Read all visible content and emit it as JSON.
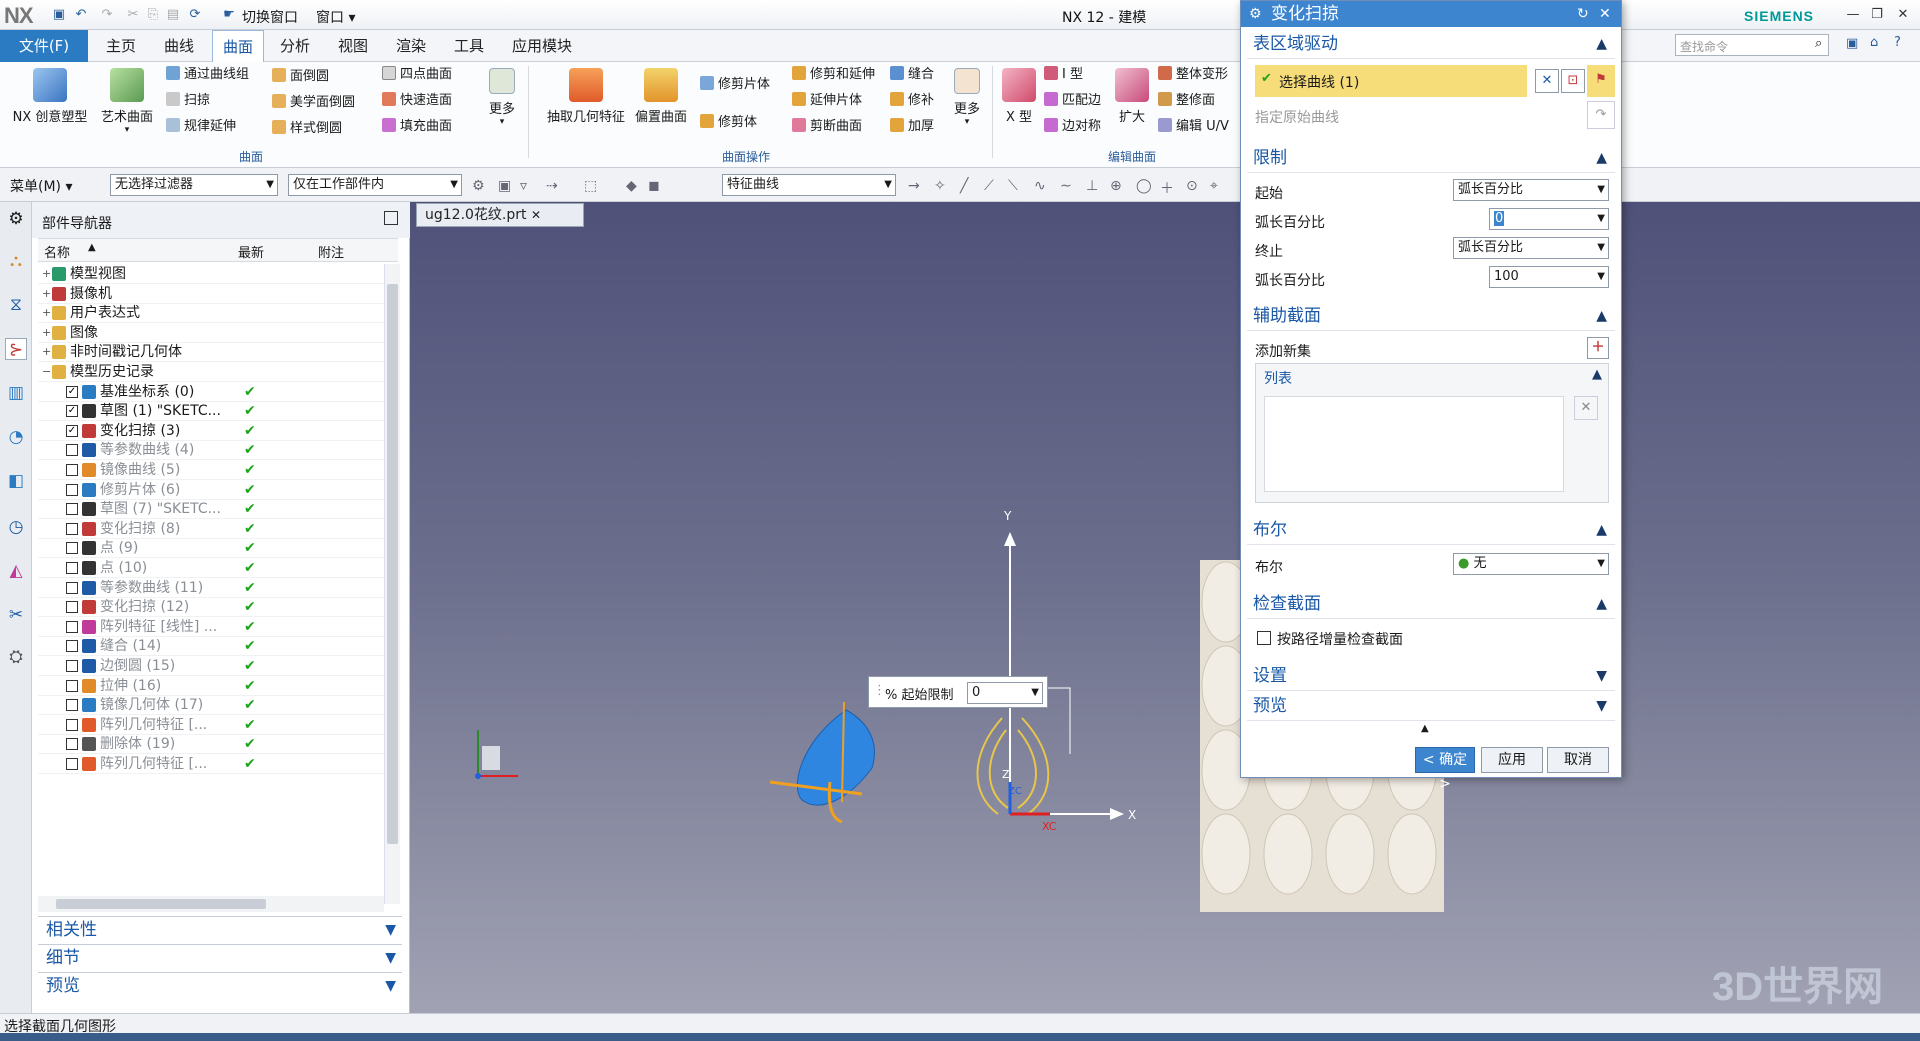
{
  "titlebar": {
    "logo": "NX",
    "switch_window": "切换窗口",
    "window": "窗口",
    "app_title": "NX 12 - 建模",
    "brand": "SIEMENS"
  },
  "menu": {
    "file": "文件(F)",
    "tabs": [
      "主页",
      "曲线",
      "曲面",
      "分析",
      "视图",
      "渲染",
      "工具",
      "应用模块"
    ],
    "search_placeholder": "查找命令"
  },
  "ribbon": {
    "big": [
      "NX 创意塑型",
      "艺术曲面",
      "抽取几何特征",
      "偏置曲面",
      "X 型",
      "扩大",
      "更多",
      "更多"
    ],
    "small": [
      "通过曲线组",
      "扫掠",
      "规律延伸",
      "面倒圆",
      "美学面倒圆",
      "样式倒圆",
      "四点曲面",
      "快速造面",
      "填充曲面",
      "修剪片体",
      "修剪体",
      "修剪和延伸",
      "延伸片体",
      "剪断曲面",
      "缝合",
      "修补",
      "加厚",
      "I 型",
      "匹配边",
      "边对称",
      "整体变形",
      "整修面",
      "编辑 U/V"
    ],
    "groups": [
      "曲面",
      "曲面操作",
      "编辑曲面"
    ]
  },
  "selbar": {
    "menu": "菜单(M)",
    "filter": "无选择过滤器",
    "scope": "仅在工作部件内",
    "curve_rule": "特征曲线"
  },
  "navigator": {
    "title": "部件导航器",
    "columns": [
      "名称",
      "最新",
      "附注"
    ],
    "rows": [
      {
        "label": "模型视图",
        "gray": false,
        "ok": false
      },
      {
        "label": "摄像机",
        "gray": false,
        "ok": false
      },
      {
        "label": "用户表达式",
        "gray": false,
        "ok": false
      },
      {
        "label": "图像",
        "gray": false,
        "ok": false
      },
      {
        "label": "非时间戳记几何体",
        "gray": false,
        "ok": false
      },
      {
        "label": "模型历史记录",
        "gray": false,
        "ok": false
      },
      {
        "label": "基准坐标系 (0)",
        "gray": false,
        "ok": true
      },
      {
        "label": "草图 (1) \"SKETC...",
        "gray": false,
        "ok": true
      },
      {
        "label": "变化扫掠 (3)",
        "gray": false,
        "ok": true
      },
      {
        "label": "等参数曲线 (4)",
        "gray": true,
        "ok": true
      },
      {
        "label": "镜像曲线 (5)",
        "gray": true,
        "ok": true
      },
      {
        "label": "修剪片体 (6)",
        "gray": true,
        "ok": true
      },
      {
        "label": "草图 (7) \"SKETC...",
        "gray": true,
        "ok": true
      },
      {
        "label": "变化扫掠 (8)",
        "gray": true,
        "ok": true
      },
      {
        "label": "点 (9)",
        "gray": true,
        "ok": true
      },
      {
        "label": "点 (10)",
        "gray": true,
        "ok": true
      },
      {
        "label": "等参数曲线 (11)",
        "gray": true,
        "ok": true
      },
      {
        "label": "变化扫掠 (12)",
        "gray": true,
        "ok": true
      },
      {
        "label": "阵列特征 [线性] ...",
        "gray": true,
        "ok": true
      },
      {
        "label": "缝合 (14)",
        "gray": true,
        "ok": true
      },
      {
        "label": "边倒圆 (15)",
        "gray": true,
        "ok": true
      },
      {
        "label": "拉伸 (16)",
        "gray": true,
        "ok": true
      },
      {
        "label": "镜像几何体 (17)",
        "gray": true,
        "ok": true
      },
      {
        "label": "阵列几何特征 [...",
        "gray": true,
        "ok": true
      },
      {
        "label": "删除体 (19)",
        "gray": true,
        "ok": true
      },
      {
        "label": "阵列几何特征 [...",
        "gray": true,
        "ok": true
      }
    ],
    "panels": [
      "相关性",
      "细节",
      "预览"
    ]
  },
  "viewport": {
    "doc_tab": "ug12.0花纹.prt",
    "limit_label": "% 起始限制",
    "limit_value": "0",
    "axis_y": "Y",
    "axis_x": "X",
    "axis_z": "Z",
    "axis_xc": "XC",
    "axis_zc": "ZC"
  },
  "dialog": {
    "title": "变化扫掠",
    "sections": {
      "driver": "表区域驱动",
      "limits": "限制",
      "aux": "辅助截面",
      "list": "列表",
      "bool": "布尔",
      "check": "检查截面",
      "settings": "设置",
      "preview": "预览"
    },
    "select_curve": "选择曲线 (1)",
    "origin_curve": "指定原始曲线",
    "start_label": "起始",
    "start_value": "弧长百分比",
    "arc_start_label": "弧长百分比",
    "arc_start_value": "0",
    "end_label": "终止",
    "end_value": "弧长百分比",
    "arc_end_label": "弧长百分比",
    "arc_end_value": "100",
    "add_set": "添加新集",
    "bool_label": "布尔",
    "bool_value": "无",
    "check_label": "按路径增量检查截面",
    "ok": "< 确定 >",
    "apply": "应用",
    "cancel": "取消"
  },
  "status": "选择截面几何图形",
  "watermark": "3D世界网"
}
